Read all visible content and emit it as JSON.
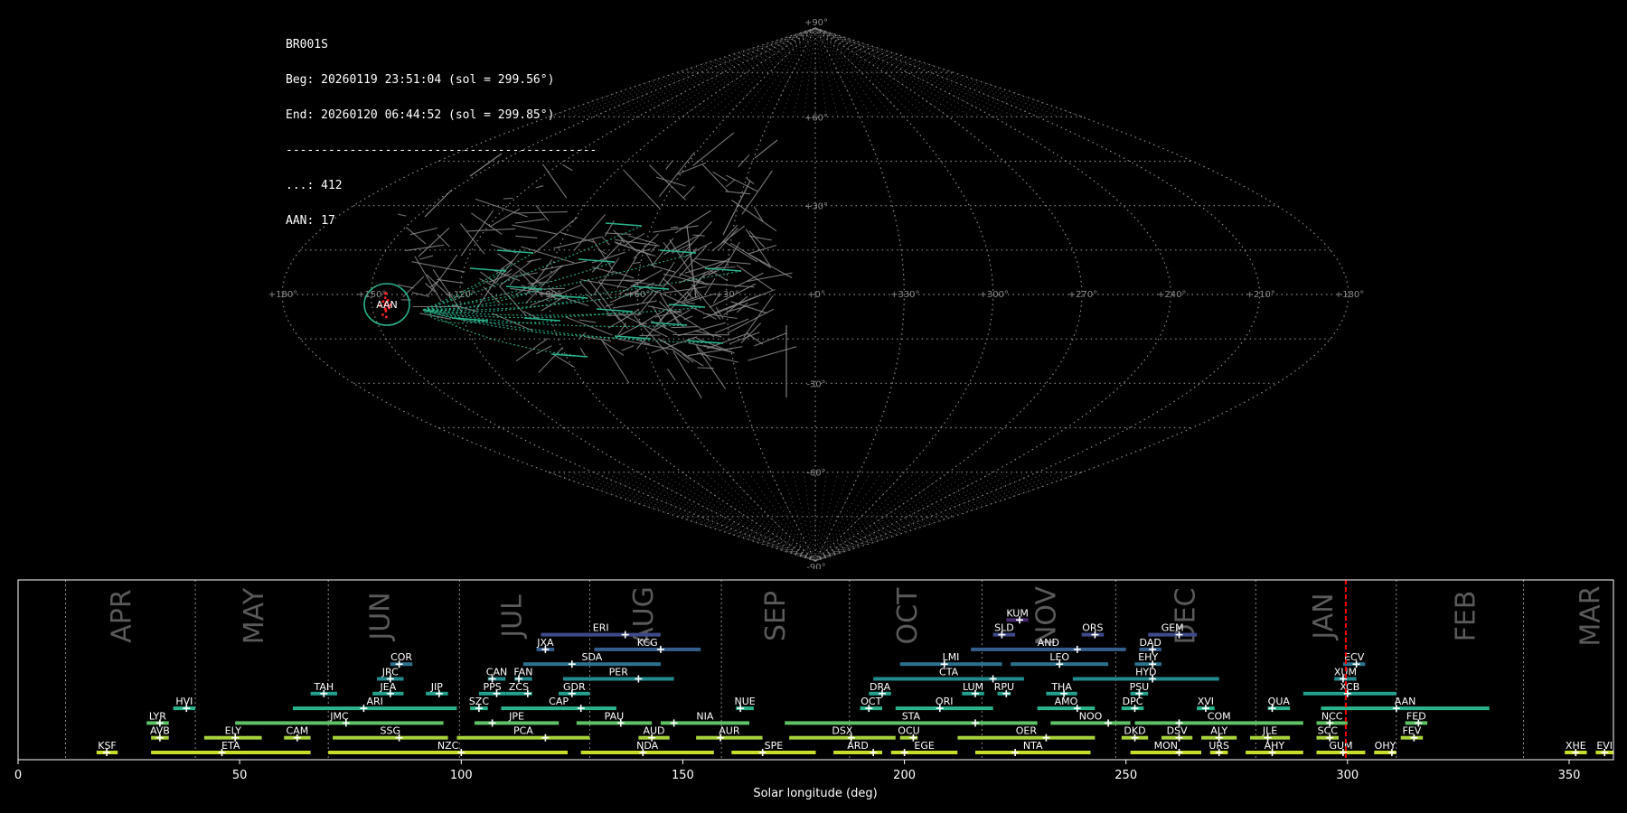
{
  "info": {
    "station": "BR001S",
    "begin": "Beg: 20260119 23:51:04 (sol = 299.56°)",
    "end": "End: 20260120 06:44:52 (sol = 299.85°)",
    "separator": "--------------------------------------------",
    "sporadic_count": "...: 412",
    "shower_count": "AAN: 17"
  },
  "sky_map": {
    "projection": "sinusoidal",
    "lon_labels": [
      "+180°",
      "+150°",
      "+120°",
      "+90°",
      "+60°",
      "+30°",
      "+0°",
      "+330°",
      "+300°",
      "+270°",
      "+240°",
      "+210°",
      "+180°"
    ],
    "lat_labels": [
      "+90°",
      "+60°",
      "+30°",
      "-30°",
      "-60°",
      "-90°"
    ],
    "highlight_shower": "AAN",
    "colors": {
      "grid": "#8c8c8c",
      "sporadic": "#8a8a8a",
      "shower": "#2ab48c",
      "radiant": "#ff2020"
    }
  },
  "chart_data": {
    "type": "timeline",
    "xlabel": "Solar longitude (deg)",
    "xlim": [
      0,
      360
    ],
    "xticks": [
      "0",
      "50",
      "100",
      "150",
      "200",
      "250",
      "300",
      "350"
    ],
    "current_sol": 299.6,
    "current_color": "#ff0000",
    "months": [
      {
        "name": "APR",
        "sol": 23.7
      },
      {
        "name": "MAY",
        "sol": 53.5
      },
      {
        "name": "JUN",
        "sol": 82.0
      },
      {
        "name": "JUL",
        "sol": 111.8
      },
      {
        "name": "AUG",
        "sol": 141.5
      },
      {
        "name": "SEP",
        "sol": 171.2
      },
      {
        "name": "OCT",
        "sol": 201.0
      },
      {
        "name": "NOV",
        "sol": 232.3
      },
      {
        "name": "DEC",
        "sol": 263.7
      },
      {
        "name": "JAN",
        "sol": 294.8
      },
      {
        "name": "FEB",
        "sol": 327.0
      },
      {
        "name": "MAR",
        "sol": 355.1
      }
    ],
    "month_separators": [
      10.7,
      40.0,
      70.0,
      99.6,
      129.0,
      158.7,
      187.6,
      217.5,
      247.7,
      279.3,
      311.0,
      339.7
    ],
    "showers": [
      {
        "code": "KSF",
        "start": 17.7,
        "end": 22.5,
        "peak": 20.0,
        "row": 0
      },
      {
        "code": "ETA",
        "start": 30.0,
        "end": 66.0,
        "peak": 46.0,
        "row": 0
      },
      {
        "code": "NZC",
        "start": 70.0,
        "end": 124.0,
        "peak": 100.0,
        "row": 0
      },
      {
        "code": "NDA",
        "start": 127.0,
        "end": 157.0,
        "peak": 141.0,
        "row": 0
      },
      {
        "code": "SPE",
        "start": 161.0,
        "end": 180.0,
        "peak": 168.0,
        "row": 0
      },
      {
        "code": "ARD",
        "start": 184.0,
        "end": 195.0,
        "peak": 193.0,
        "row": 0
      },
      {
        "code": "EGE",
        "start": 197.0,
        "end": 212.0,
        "peak": 200.0,
        "row": 0
      },
      {
        "code": "NTA",
        "start": 216.0,
        "end": 242.0,
        "peak": 225.0,
        "row": 0
      },
      {
        "code": "MON",
        "start": 251.0,
        "end": 267.0,
        "peak": 262.0,
        "row": 0
      },
      {
        "code": "URS",
        "start": 269.0,
        "end": 273.0,
        "peak": 271.0,
        "row": 0
      },
      {
        "code": "AHY",
        "start": 277.0,
        "end": 290.0,
        "peak": 283.0,
        "row": 0
      },
      {
        "code": "GUM",
        "start": 293.0,
        "end": 304.0,
        "peak": 299.0,
        "row": 0
      },
      {
        "code": "OHY",
        "start": 306.0,
        "end": 311.0,
        "peak": 310.0,
        "row": 0
      },
      {
        "code": "XHE",
        "start": 349.0,
        "end": 354.0,
        "peak": 351.5,
        "row": 0
      },
      {
        "code": "EVI",
        "start": 356.0,
        "end": 360.0,
        "peak": 358.0,
        "row": 0
      },
      {
        "code": "AVB",
        "start": 30.0,
        "end": 34.0,
        "peak": 32.0,
        "row": 1
      },
      {
        "code": "ELY",
        "start": 42.0,
        "end": 55.0,
        "peak": 49.0,
        "row": 1
      },
      {
        "code": "CAM",
        "start": 60.0,
        "end": 66.0,
        "peak": 63.0,
        "row": 1
      },
      {
        "code": "SSG",
        "start": 71.0,
        "end": 97.0,
        "peak": 86.0,
        "row": 1
      },
      {
        "code": "PCA",
        "start": 99.0,
        "end": 129.0,
        "peak": 119.0,
        "row": 1
      },
      {
        "code": "AUD",
        "start": 140.0,
        "end": 147.0,
        "peak": 143.0,
        "row": 1
      },
      {
        "code": "AUR",
        "start": 153.0,
        "end": 168.0,
        "peak": 158.5,
        "row": 1
      },
      {
        "code": "DSX",
        "start": 174.0,
        "end": 198.0,
        "peak": 188.0,
        "row": 1
      },
      {
        "code": "OCU",
        "start": 199.0,
        "end": 203.0,
        "peak": 202.0,
        "row": 1
      },
      {
        "code": "OER",
        "start": 212.0,
        "end": 243.0,
        "peak": 232.0,
        "row": 1
      },
      {
        "code": "DKD",
        "start": 249.0,
        "end": 255.0,
        "peak": 252.0,
        "row": 1
      },
      {
        "code": "DSV",
        "start": 258.0,
        "end": 265.0,
        "peak": 262.0,
        "row": 1
      },
      {
        "code": "ALY",
        "start": 267.0,
        "end": 275.0,
        "peak": 271.0,
        "row": 1
      },
      {
        "code": "JLE",
        "start": 278.0,
        "end": 287.0,
        "peak": 282.0,
        "row": 1
      },
      {
        "code": "SCC",
        "start": 293.0,
        "end": 298.0,
        "peak": 296.0,
        "row": 1
      },
      {
        "code": "FEV",
        "start": 312.0,
        "end": 317.0,
        "peak": 315.0,
        "row": 1
      },
      {
        "code": "LYR",
        "start": 29.0,
        "end": 34.0,
        "peak": 32.0,
        "row": 2
      },
      {
        "code": "JMC",
        "start": 49.0,
        "end": 96.0,
        "peak": 74.0,
        "row": 2
      },
      {
        "code": "JPE",
        "start": 103.0,
        "end": 122.0,
        "peak": 107.0,
        "row": 2
      },
      {
        "code": "PAU",
        "start": 126.0,
        "end": 143.0,
        "peak": 136.0,
        "row": 2
      },
      {
        "code": "NIA",
        "start": 145.0,
        "end": 165.0,
        "peak": 148.0,
        "row": 2
      },
      {
        "code": "STA",
        "start": 173.0,
        "end": 230.0,
        "peak": 216.0,
        "row": 2
      },
      {
        "code": "NOO",
        "start": 233.0,
        "end": 251.0,
        "peak": 246.0,
        "row": 2
      },
      {
        "code": "COM",
        "start": 252.0,
        "end": 290.0,
        "peak": 262.0,
        "row": 2
      },
      {
        "code": "NCC",
        "start": 293.0,
        "end": 300.0,
        "peak": 296.0,
        "row": 2
      },
      {
        "code": "FED",
        "start": 313.0,
        "end": 318.0,
        "peak": 316.0,
        "row": 2
      },
      {
        "code": "HVI",
        "start": 35.0,
        "end": 40.0,
        "peak": 38.0,
        "row": 3
      },
      {
        "code": "ARI",
        "start": 62.0,
        "end": 99.0,
        "peak": 78.0,
        "row": 3
      },
      {
        "code": "SZC",
        "start": 102.0,
        "end": 106.0,
        "peak": 104.0,
        "row": 3
      },
      {
        "code": "CAP",
        "start": 109.0,
        "end": 135.0,
        "peak": 127.0,
        "row": 3
      },
      {
        "code": "NUE",
        "start": 162.0,
        "end": 166.0,
        "peak": 163.0,
        "row": 3
      },
      {
        "code": "OCT",
        "start": 190.0,
        "end": 195.0,
        "peak": 192.0,
        "row": 3
      },
      {
        "code": "ORI",
        "start": 198.0,
        "end": 220.0,
        "peak": 208.0,
        "row": 3
      },
      {
        "code": "AMO",
        "start": 230.0,
        "end": 243.0,
        "peak": 239.0,
        "row": 3
      },
      {
        "code": "DPC",
        "start": 249.0,
        "end": 254.0,
        "peak": 252.0,
        "row": 3
      },
      {
        "code": "XVI",
        "start": 266.0,
        "end": 270.0,
        "peak": 268.0,
        "row": 3
      },
      {
        "code": "QUA",
        "start": 282.0,
        "end": 287.0,
        "peak": 283.0,
        "row": 3
      },
      {
        "code": "AAN",
        "start": 294.0,
        "end": 332.0,
        "peak": 311.0,
        "row": 3
      },
      {
        "code": "TAH",
        "start": 66.0,
        "end": 72.0,
        "peak": 69.0,
        "row": 4
      },
      {
        "code": "JEA",
        "start": 80.0,
        "end": 87.0,
        "peak": 84.0,
        "row": 4
      },
      {
        "code": "JIP",
        "start": 92.0,
        "end": 97.0,
        "peak": 95.0,
        "row": 4
      },
      {
        "code": "PPS",
        "start": 104.0,
        "end": 110.0,
        "peak": 108.0,
        "row": 4
      },
      {
        "code": "ZCS",
        "start": 110.0,
        "end": 116.0,
        "peak": 115.0,
        "row": 4
      },
      {
        "code": "GDR",
        "start": 122.0,
        "end": 129.0,
        "peak": 125.0,
        "row": 4
      },
      {
        "code": "DRA",
        "start": 192.0,
        "end": 197.0,
        "peak": 195.0,
        "row": 4
      },
      {
        "code": "LUM",
        "start": 213.0,
        "end": 218.0,
        "peak": 216.0,
        "row": 4
      },
      {
        "code": "RPU",
        "start": 221.0,
        "end": 224.0,
        "peak": 223.0,
        "row": 4
      },
      {
        "code": "THA",
        "start": 232.0,
        "end": 239.0,
        "peak": 236.0,
        "row": 4
      },
      {
        "code": "PSU",
        "start": 251.0,
        "end": 255.0,
        "peak": 253.0,
        "row": 4
      },
      {
        "code": "XCB",
        "start": 290.0,
        "end": 311.0,
        "peak": 300.0,
        "row": 4
      },
      {
        "code": "JRC",
        "start": 81.0,
        "end": 87.0,
        "peak": 84.0,
        "row": 5
      },
      {
        "code": "CAN",
        "start": 106.0,
        "end": 110.0,
        "peak": 107.0,
        "row": 5
      },
      {
        "code": "FAN",
        "start": 112.0,
        "end": 116.0,
        "peak": 113.0,
        "row": 5
      },
      {
        "code": "PER",
        "start": 123.0,
        "end": 148.0,
        "peak": 140.0,
        "row": 5
      },
      {
        "code": "CTA",
        "start": 193.0,
        "end": 227.0,
        "peak": 220.0,
        "row": 5
      },
      {
        "code": "HYD",
        "start": 238.0,
        "end": 271.0,
        "peak": 256.0,
        "row": 5
      },
      {
        "code": "XUM",
        "start": 297.0,
        "end": 302.0,
        "peak": 299.0,
        "row": 5
      },
      {
        "code": "COR",
        "start": 84.0,
        "end": 89.0,
        "peak": 86.0,
        "row": 6
      },
      {
        "code": "SDA",
        "start": 114.0,
        "end": 145.0,
        "peak": 125.0,
        "row": 6
      },
      {
        "code": "LMI",
        "start": 199.0,
        "end": 222.0,
        "peak": 209.0,
        "row": 6
      },
      {
        "code": "LEO",
        "start": 224.0,
        "end": 246.0,
        "peak": 235.0,
        "row": 6
      },
      {
        "code": "EHY",
        "start": 252.0,
        "end": 258.0,
        "peak": 256.0,
        "row": 6
      },
      {
        "code": "ECV",
        "start": 299.0,
        "end": 304.0,
        "peak": 302.0,
        "row": 6
      },
      {
        "code": "JXA",
        "start": 117.0,
        "end": 121.0,
        "peak": 119.0,
        "row": 7
      },
      {
        "code": "KCG",
        "start": 130.0,
        "end": 154.0,
        "peak": 145.0,
        "row": 7
      },
      {
        "code": "AND",
        "start": 215.0,
        "end": 250.0,
        "peak": 239.0,
        "row": 7
      },
      {
        "code": "DAD",
        "start": 253.0,
        "end": 258.0,
        "peak": 256.0,
        "row": 7
      },
      {
        "code": "ERI",
        "start": 118.0,
        "end": 145.0,
        "peak": 137.0,
        "row": 8
      },
      {
        "code": "SLD",
        "start": 220.0,
        "end": 225.0,
        "peak": 222.0,
        "row": 8
      },
      {
        "code": "ORS",
        "start": 240.0,
        "end": 245.0,
        "peak": 243.0,
        "row": 8
      },
      {
        "code": "GEM",
        "start": 255.0,
        "end": 266.0,
        "peak": 262.0,
        "row": 8
      },
      {
        "code": "KUM",
        "start": 223.0,
        "end": 228.0,
        "peak": 226.0,
        "row": 9
      }
    ]
  }
}
